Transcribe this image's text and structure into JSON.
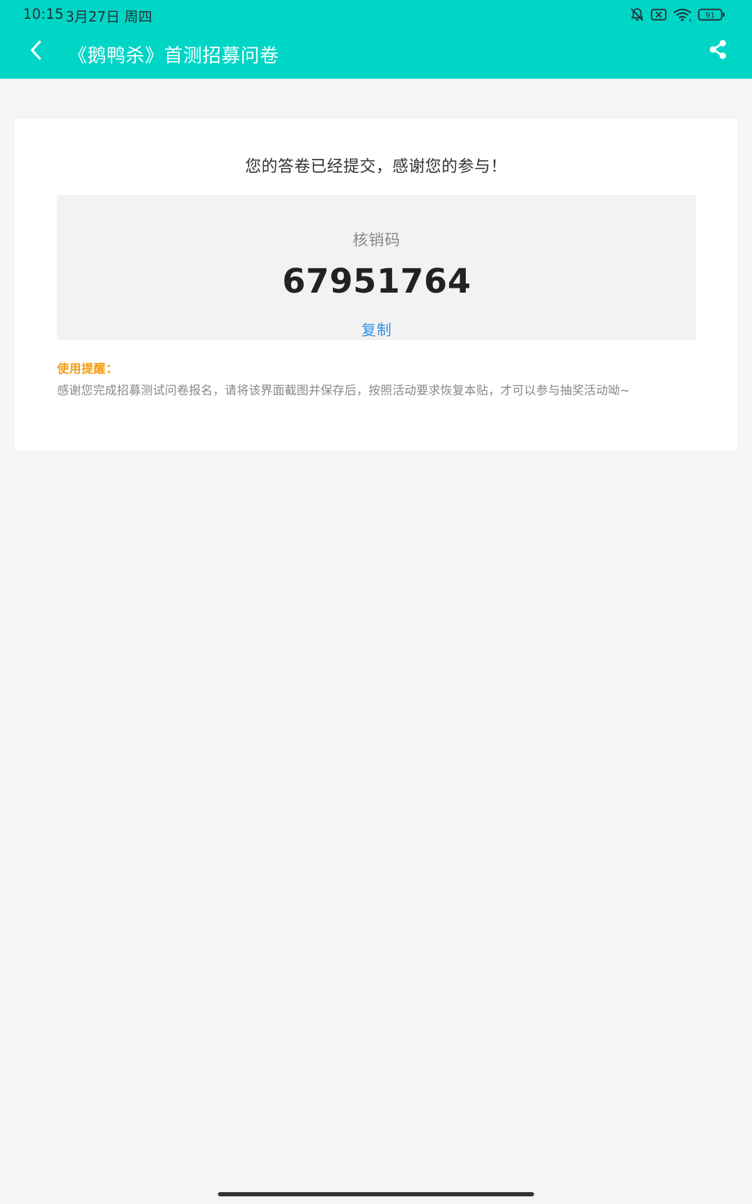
{
  "status_bar": {
    "time": "10:15",
    "date": "3月27日 周四",
    "battery": "91",
    "icons": [
      "mute-bell-icon",
      "no-sim-icon",
      "wifi-icon",
      "battery-icon"
    ]
  },
  "app_bar": {
    "title": "《鹅鸭杀》首测招募问卷",
    "back_icon": "chevron-left-icon",
    "share_icon": "share-icon",
    "color": "#00d6c6"
  },
  "card": {
    "success_message": "您的答卷已经提交，感谢您的参与！",
    "code_label": "核销码",
    "code_value": "67951764",
    "copy_label": "复制",
    "reminder_title": "使用提醒：",
    "reminder_text": "感谢您完成招募测试问卷报名，请将该界面截图并保存后，按照活动要求恢复本贴，才可以参与抽奖活动呦~"
  },
  "colors": {
    "accent": "#00d6c6",
    "link": "#2c8fe6",
    "warning": "#f39c12"
  }
}
